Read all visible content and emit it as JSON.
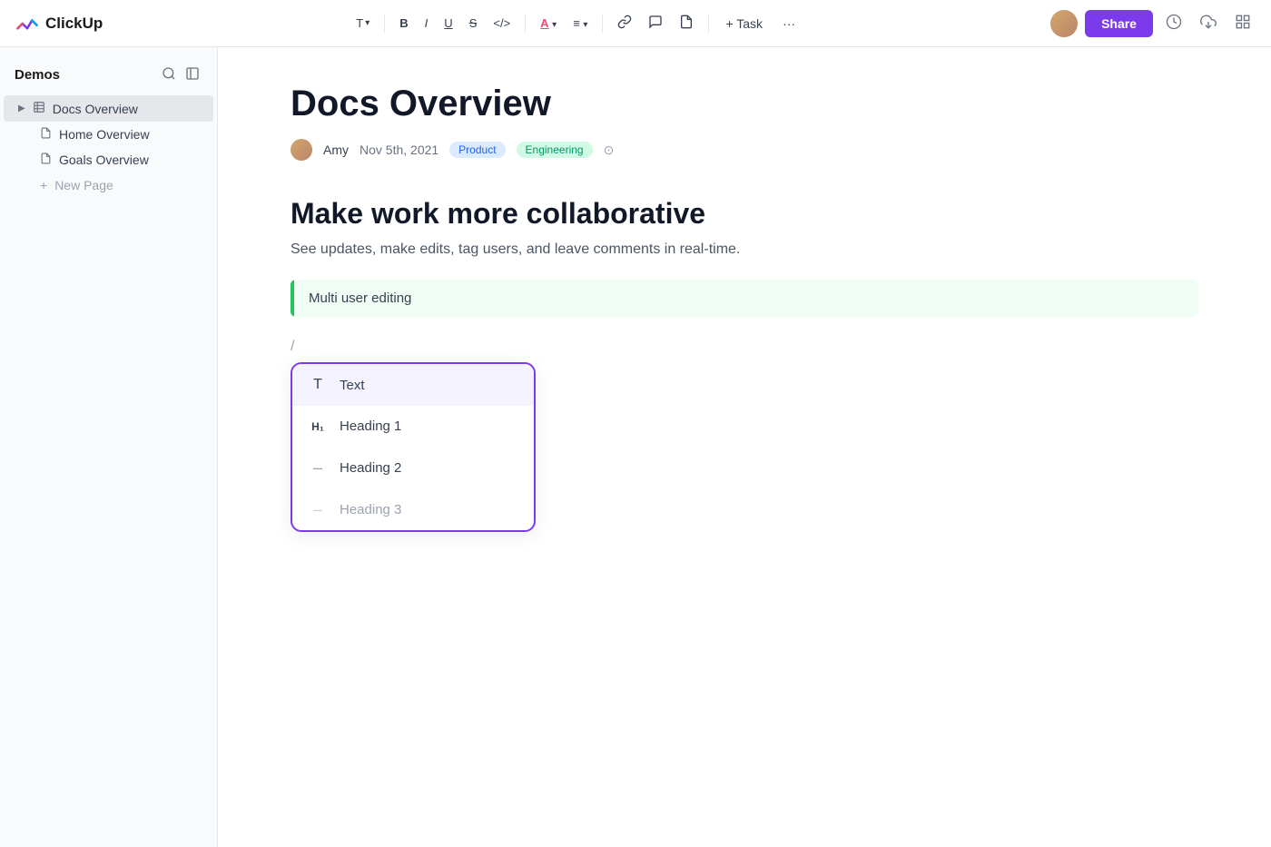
{
  "app": {
    "name": "ClickUp"
  },
  "toolbar": {
    "share_label": "Share",
    "task_label": "+ Task",
    "more_label": "···",
    "text_format": "T",
    "bold": "B",
    "italic": "I",
    "underline": "U",
    "strikethrough": "S",
    "code": "</>",
    "font_color": "A",
    "align": "≡",
    "link": "🔗",
    "comment": "💬",
    "attachment": "📎"
  },
  "sidebar": {
    "workspace_name": "Demos",
    "items": [
      {
        "label": "Docs Overview",
        "type": "docs",
        "active": true
      },
      {
        "label": "Home Overview",
        "type": "page"
      },
      {
        "label": "Goals Overview",
        "type": "page"
      }
    ],
    "new_page_label": "New Page"
  },
  "document": {
    "title": "Docs Overview",
    "author": "Amy",
    "date": "Nov 5th, 2021",
    "tags": [
      "Product",
      "Engineering"
    ],
    "heading": "Make work more collaborative",
    "subheading": "See updates, make edits, tag users, and leave comments in real-time.",
    "callout": "Multi user editing",
    "slash_char": "/"
  },
  "dropdown_menu": {
    "items": [
      {
        "icon": "T",
        "label": "Text",
        "icon_type": "text"
      },
      {
        "icon": "H₁",
        "label": "Heading 1",
        "icon_type": "h1"
      },
      {
        "icon": "–",
        "label": "Heading 2",
        "icon_type": "h2"
      },
      {
        "icon": "–",
        "label": "Heading 3",
        "icon_type": "h3"
      }
    ]
  }
}
